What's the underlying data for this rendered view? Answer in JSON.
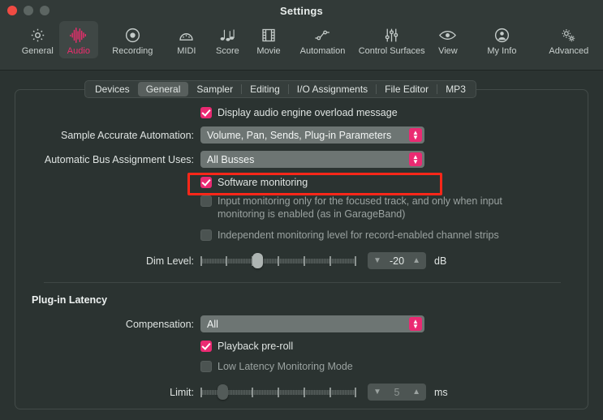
{
  "window": {
    "title": "Settings",
    "traffic_lights": [
      "close-button",
      "minimize-button",
      "maximize-button"
    ]
  },
  "toolbar": {
    "items": [
      {
        "label": "General",
        "icon": "gear-icon",
        "selected": false
      },
      {
        "label": "Audio",
        "icon": "waveform-icon",
        "selected": true
      },
      {
        "label": "Recording",
        "icon": "record-circle-icon",
        "selected": false
      },
      {
        "label": "MIDI",
        "icon": "midi-connector-icon",
        "selected": false
      },
      {
        "label": "Score",
        "icon": "music-notes-icon",
        "selected": false
      },
      {
        "label": "Movie",
        "icon": "film-strip-icon",
        "selected": false
      },
      {
        "label": "Automation",
        "icon": "automation-nodes-icon",
        "selected": false
      },
      {
        "label": "Control Surfaces",
        "icon": "faders-icon",
        "selected": false
      },
      {
        "label": "View",
        "icon": "eye-icon",
        "selected": false
      },
      {
        "label": "My Info",
        "icon": "person-circle-icon",
        "selected": false
      },
      {
        "label": "Advanced",
        "icon": "double-gear-icon",
        "selected": false
      }
    ]
  },
  "tabs": [
    {
      "label": "Devices",
      "selected": false
    },
    {
      "label": "General",
      "selected": true
    },
    {
      "label": "Sampler",
      "selected": false
    },
    {
      "label": "Editing",
      "selected": false
    },
    {
      "label": "I/O Assignments",
      "selected": false
    },
    {
      "label": "File Editor",
      "selected": false
    },
    {
      "label": "MP3",
      "selected": false
    }
  ],
  "general_pane": {
    "overload_checkbox": {
      "label": "Display audio engine overload message",
      "checked": true
    },
    "sample_accurate_automation": {
      "label": "Sample Accurate Automation:",
      "value": "Volume, Pan, Sends, Plug-in Parameters"
    },
    "automatic_bus_assignment": {
      "label": "Automatic Bus Assignment Uses:",
      "value": "All Busses"
    },
    "software_monitoring": {
      "label": "Software monitoring",
      "checked": true,
      "highlighted": true
    },
    "input_monitoring_focused": {
      "label": "Input monitoring only for the focused track, and only when input monitoring is enabled (as in GarageBand)",
      "checked": false
    },
    "independent_monitoring_level": {
      "label": "Independent monitoring level for record-enabled channel strips",
      "checked": false
    },
    "dim_level": {
      "label": "Dim Level:",
      "value": "-20",
      "unit": "dB",
      "slider_percent": 36
    }
  },
  "plugin_latency": {
    "heading": "Plug-in Latency",
    "compensation": {
      "label": "Compensation:",
      "value": "All"
    },
    "playback_preroll": {
      "label": "Playback pre-roll",
      "checked": true
    },
    "low_latency_monitoring": {
      "label": "Low Latency Monitoring Mode",
      "checked": false
    },
    "limit": {
      "label": "Limit:",
      "value": "5",
      "unit": "ms",
      "slider_percent": 12
    }
  },
  "colors": {
    "accent": "#ea2a72",
    "window_bg": "#2b3331",
    "chrome_bg": "#323a38",
    "annotation": "#fe2719"
  },
  "icons": {
    "chevron_down": "⌄",
    "chevron_up": "⌃",
    "stepper_up": "▲",
    "stepper_down": "▼"
  }
}
